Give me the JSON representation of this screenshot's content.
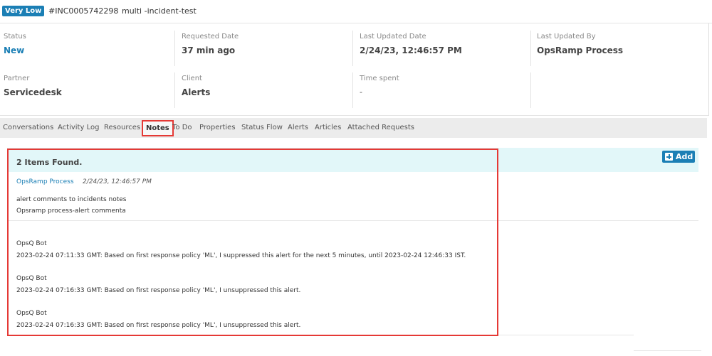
{
  "header": {
    "priority": "Very Low",
    "incident_id": "#INC0005742298",
    "title": "multi -incident-test"
  },
  "details": {
    "status": {
      "label": "Status",
      "value": "New"
    },
    "requested_date": {
      "label": "Requested Date",
      "value": "37 min ago"
    },
    "last_updated_date": {
      "label": "Last Updated Date",
      "value": "2/24/23, 12:46:57 PM"
    },
    "last_updated_by": {
      "label": "Last Updated By",
      "value": "OpsRamp Process"
    },
    "partner": {
      "label": "Partner",
      "value": "Servicedesk"
    },
    "client": {
      "label": "Client",
      "value": "Alerts"
    },
    "time_spent": {
      "label": "Time spent",
      "value": "-"
    }
  },
  "tabs": [
    "Conversations",
    "Activity Log",
    "Resources",
    "Notes",
    "To Do",
    "Properties",
    "Status Flow",
    "Alerts",
    "Articles",
    "Attached Requests"
  ],
  "notes": {
    "count_label": "2 Items Found.",
    "add_label": "Add",
    "note1": {
      "author": "OpsRamp Process",
      "time": "2/24/23, 12:46:57 PM",
      "line1": "alert comments to incidents notes",
      "line2": "Opsramp process-alert commenta"
    },
    "bot_entries": [
      {
        "name": "OpsQ Bot",
        "text": "2023-02-24 07:11:33 GMT: Based on first response policy 'ML', I suppressed this alert for the next 5 minutes, until 2023-02-24 12:46:33 IST."
      },
      {
        "name": "OpsQ Bot",
        "text": "2023-02-24 07:16:33 GMT: Based on first response policy 'ML', I unsuppressed this alert."
      },
      {
        "name": "OpsQ Bot",
        "text": "2023-02-24 07:16:33 GMT: Based on first response policy 'ML', I unsuppressed this alert."
      }
    ]
  },
  "colors": {
    "accent": "#1b7fb5",
    "highlight": "#e53935",
    "panel_header": "#e2f7f9"
  }
}
